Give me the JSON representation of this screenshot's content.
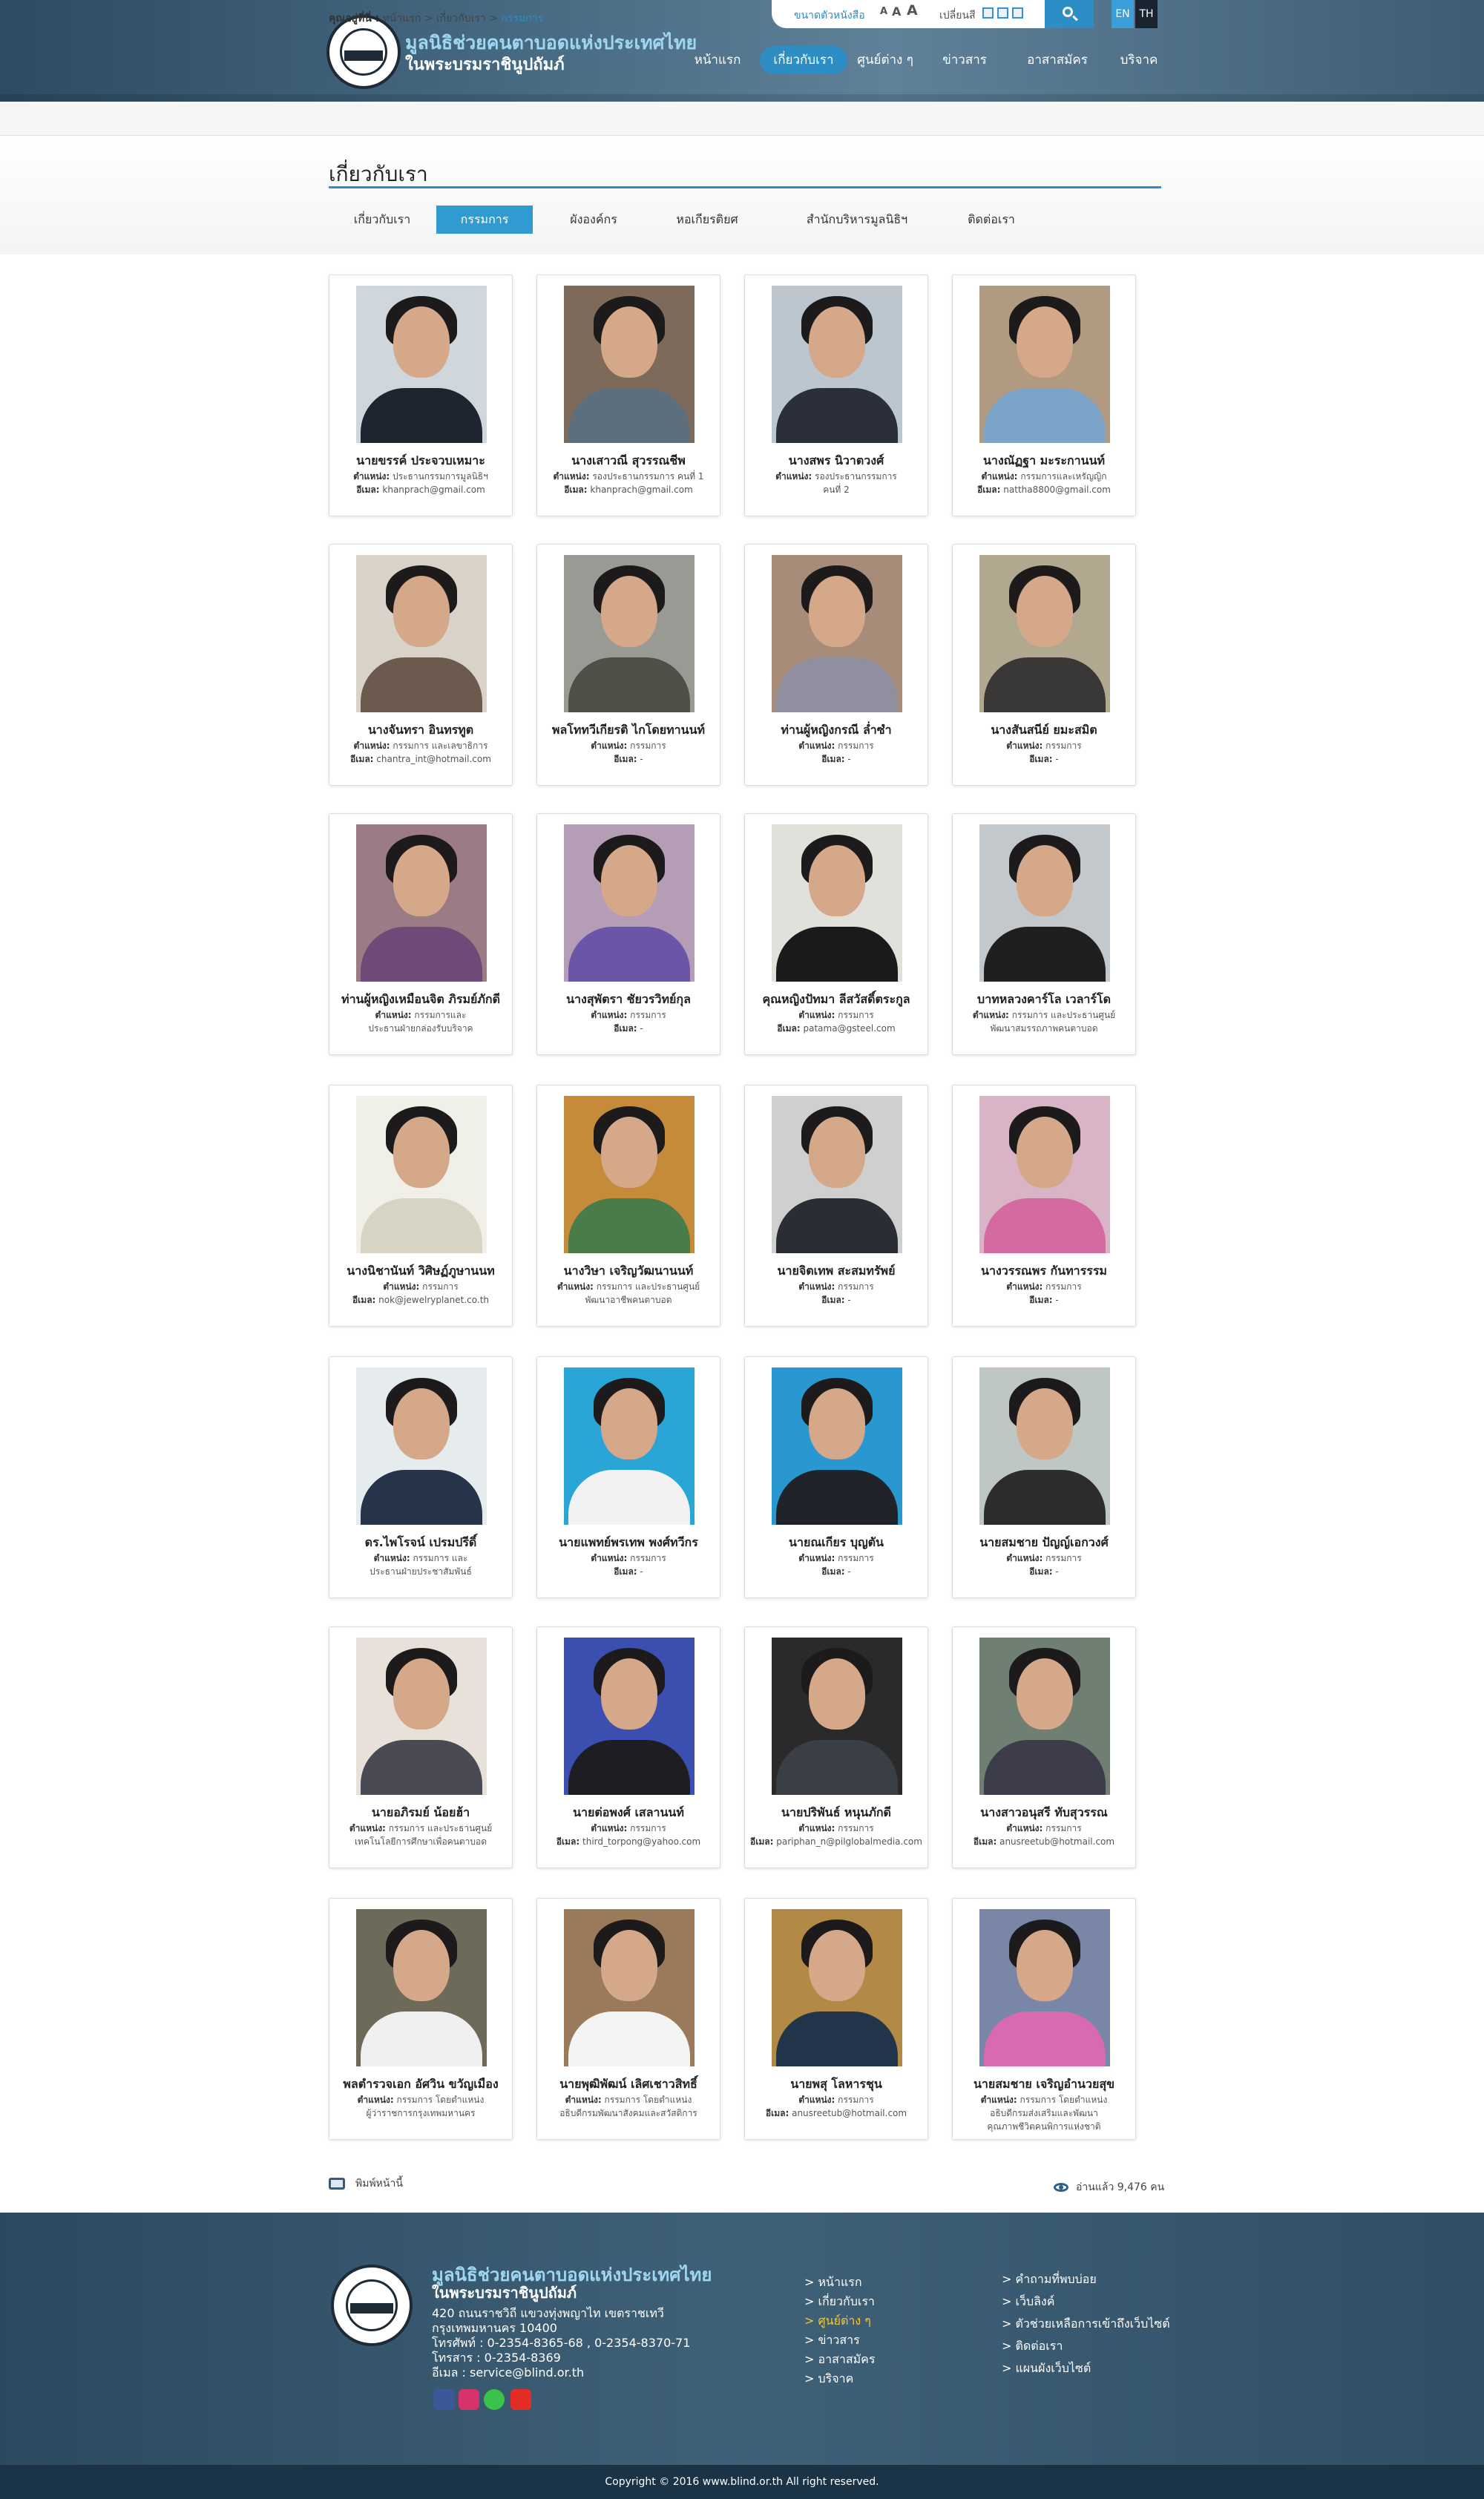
{
  "header": {
    "org_name": "มูลนิธิช่วยคนตาบอดแห่งประเทศไทย",
    "org_sub": "ในพระบรมราชินูปถัมภ์",
    "font_size_label": "ขนาดตัวหนังสือ",
    "font_sizes": [
      "A",
      "A",
      "A"
    ],
    "change_label": "เปลี่ยนสี",
    "lang_en": "EN",
    "lang_th": "TH"
  },
  "nav": [
    {
      "label": "หน้าแรก"
    },
    {
      "label": "เกี่ยวกับเรา"
    },
    {
      "label": "ศูนย์ต่าง ๆ"
    },
    {
      "label": "ข่าวสาร"
    },
    {
      "label": "อาสาสมัคร"
    },
    {
      "label": "บริจาค"
    }
  ],
  "breadcrumb": {
    "prefix": "คุณอยู่ที่นี่ :",
    "path": "หน้าแรก > เกี่ยวกับเรา >",
    "current": "กรรมการ"
  },
  "page_title": "เกี่ยวกับเรา",
  "tabs": [
    {
      "label": "เกี่ยวกับเรา"
    },
    {
      "label": "กรรมการ"
    },
    {
      "label": "ผังองค์กร"
    },
    {
      "label": "หอเกียรติยศ"
    },
    {
      "label": "สำนักบริหารมูลนิธิฯ"
    },
    {
      "label": "ติดต่อเรา"
    }
  ],
  "labels": {
    "position": "ตำแหน่ง:",
    "email": "อีเมล:"
  },
  "members": [
    {
      "name": "นายขรรค์ ประจวบเหมาะ",
      "position": "ประธานกรรมการมูลนิธิฯ",
      "email": "khanprach@gmail.com"
    },
    {
      "name": "นางเสาวณี สุวรรณชีพ",
      "position": "รองประธานกรรมการ คนที่ 1",
      "email": "khanprach@gmail.com"
    },
    {
      "name": "นางสพร นิวาตวงศ์",
      "position": "รองประธานกรรมการ",
      "position2": "คนที่ 2",
      "email": ""
    },
    {
      "name": "นางณัฏฐา มะระกานนท์",
      "position": "กรรมการและเหรัญญิก",
      "email": "nattha8800@gmail.com"
    },
    {
      "name": "นางจันทรา อินทรทูต",
      "position": "กรรมการ และเลขาธิการ",
      "email": "chantra_int@hotmail.com"
    },
    {
      "name": "พลโททวีเกียรติ ไกโดยทานนท์",
      "position": "กรรมการ",
      "email": "-"
    },
    {
      "name": "ท่านผู้หญิงกรณี   ล่ำซำ",
      "position": "กรรมการ",
      "email": "-"
    },
    {
      "name": "นางสันสนีย์ ยมะสมิต",
      "position": "กรรมการ",
      "email": "-"
    },
    {
      "name": "ท่านผู้หญิงเหมือนจิต ภิรมย์ภักดี",
      "position": "กรรมการและ",
      "position2": "ประธานฝ่ายกล่องรับบริจาค",
      "email": ""
    },
    {
      "name": "นางสุพัตรา ชัยวรวิทย์กุล",
      "position": "กรรมการ",
      "email": "-"
    },
    {
      "name": "คุณหญิงปัทมา ลีสวัสดิ์ตระกูล",
      "position": "กรรมการ",
      "email": "patama@gsteel.com"
    },
    {
      "name": "บาทหลวงคาร์โล เวลาร์โด",
      "position": "กรรมการ และประธานศูนย์",
      "position2": "พัฒนาสมรรถภาพคนตาบอด",
      "email": ""
    },
    {
      "name": "นางนิชานันท์ วิศิษฏ์ภูษานนท",
      "position": "กรรมการ",
      "email": "nok@jewelryplanet.co.th"
    },
    {
      "name": "นางวิษา เจริญวัฒนานนท์",
      "position": "กรรมการ และประธานศูนย์",
      "position2": "พัฒนาอาชีพคนตาบอด",
      "email": ""
    },
    {
      "name": "นายจิตเทพ สะสมทรัพย์",
      "position": "กรรมการ",
      "email": "-"
    },
    {
      "name": "นางวรรณพร กันทารรรม",
      "position": "กรรมการ",
      "email": "-"
    },
    {
      "name": "ดร.ไพโรจน์ เปรมปรีดิ์",
      "position": "กรรมการ และ",
      "position2": "ประธานฝ่ายประชาสัมพันธ์",
      "email": ""
    },
    {
      "name": "นายแพทย์พรเทพ พงศ์ทวีกร",
      "position": "กรรมการ",
      "email": "-"
    },
    {
      "name": "นายณเกียร บุญตัน",
      "position": "กรรมการ",
      "email": "-"
    },
    {
      "name": "นายสมชาย ปัญญ์เอกวงศ์",
      "position": "กรรมการ",
      "email": "-"
    },
    {
      "name": "นายอภิรมย์ น้อยฮ้า",
      "position": "กรรมการ และประธานศูนย์",
      "position2": "เทคโนโลยีการศึกษาเพื่อคนตาบอด",
      "email": ""
    },
    {
      "name": "นายต่อพงศ์ เสลานนท์",
      "position": "กรรมการ",
      "email": "third_torpong@yahoo.com"
    },
    {
      "name": "นายปริพันธ์ หนุนภักดี",
      "position": "กรรมการ",
      "email": "pariphan_n@pilglobalmedia.com"
    },
    {
      "name": "นางสาวอนุสรี ทับสุวรรณ",
      "position": "กรรมการ",
      "email": "anusreetub@hotmail.com"
    },
    {
      "name": "พลตำรวจเอก อัศวิน ขวัญเมือง",
      "position": "กรรมการ โดยตำแหน่ง",
      "position2": "ผู้ว่าราชการกรุงเทพมหานคร",
      "email": ""
    },
    {
      "name": "นายพุฒิพัฒน์ เลิศเชาวสิทธิ์",
      "position": "กรรมการ โดยตำแหน่ง",
      "position2": "อธิบดีกรมพัฒนาสังคมและสวัสดิการ",
      "email": ""
    },
    {
      "name": "นายพสุ โลหารชุน",
      "position": "กรรมการ",
      "email": "anusreetub@hotmail.com"
    },
    {
      "name": "นายสมชาย เจริญอำนวยสุข",
      "position": "กรรมการ โดยตำแหน่ง",
      "position2": "อธิบดีกรมส่งเสริมและพัฒนา",
      "position3": "คุณภาพชีวิตคนพิการแห่งชาติ",
      "email": ""
    }
  ],
  "print_label": "พิมพ์หน้านี้",
  "views_label": "อ่านแล้ว 9,476 คน",
  "footer": {
    "org_name": "มูลนิธิช่วยคนตาบอดแห่งประเทศไทย",
    "org_sub": "ในพระบรมราชินูปถัมภ์",
    "address1": "420 ถนนราชวิถี แขวงทุ่งพญาไท เขตราชเทวี",
    "address2": "กรุงเทพมหานคร 10400",
    "phone": "โทรศัพท์ : 0-2354-8365-68 , 0-2354-8370-71",
    "fax": "โทรสาร : 0-2354-8369",
    "email": "อีเมล : service@blind.or.th",
    "links_col1": [
      "> หน้าแรก",
      "> เกี่ยวกับเรา",
      "> ศูนย์ต่าง ๆ",
      "> ข่าวสาร",
      "> อาสาสมัคร",
      "> บริจาค"
    ],
    "links_col2": [
      "> คำถามที่พบบ่อย",
      "> เว็บลิงค์",
      "> ตัวช่วยเหลือการเข้าถึงเว็บไซต์",
      "> ติดต่อเรา",
      "> แผนผังเว็บไซต์"
    ],
    "copyright": "Copyright © 2016 www.blind.or.th All right reserved."
  },
  "colors": {
    "accent": "#2f8cc4",
    "header_bg": "#3d5d74",
    "footer_bg": "#2f4f66"
  }
}
